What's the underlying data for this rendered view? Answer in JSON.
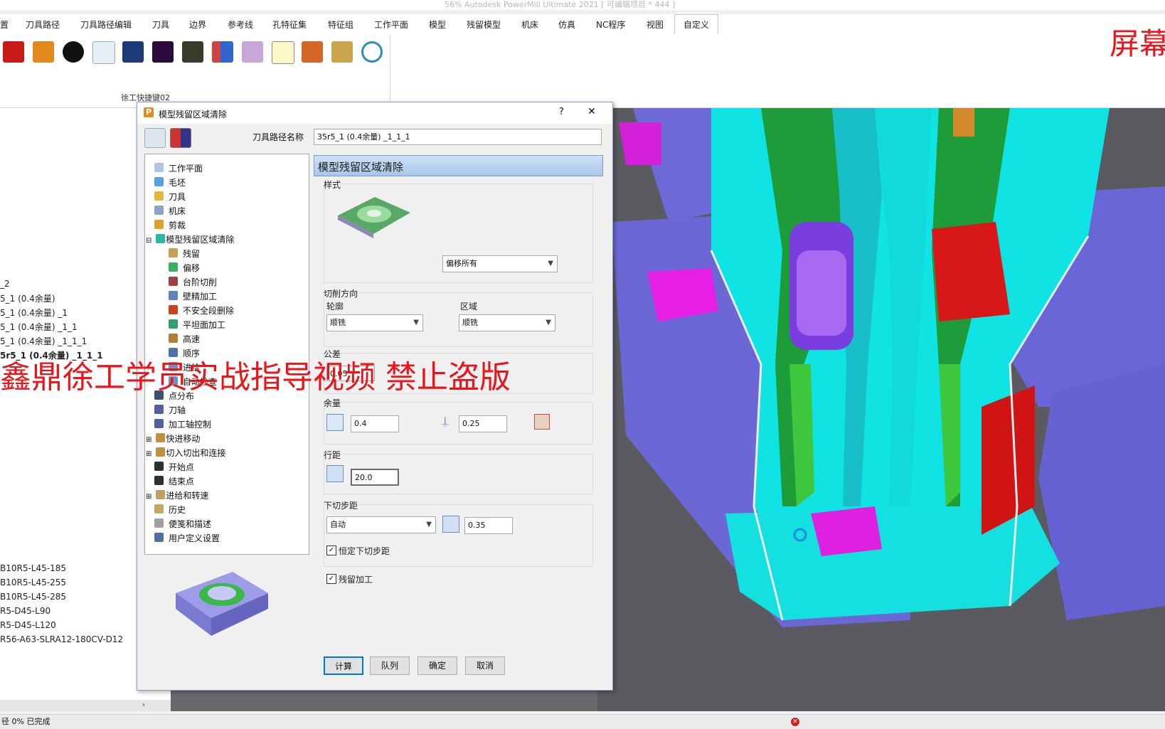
{
  "window": {
    "title": "56% Autodesk PowerMill Ultimate 2021    [ 可编辑项目 * 444 ]"
  },
  "ribbon": {
    "tabs": [
      "置",
      "刀具路径",
      "刀具路径编辑",
      "刀具",
      "边界",
      "参考线",
      "孔特征集",
      "特征组",
      "工作平面",
      "模型",
      "残留模型",
      "机床",
      "仿真",
      "NC程序",
      "视图",
      "自定义"
    ],
    "group_label": "徐工快捷键02"
  },
  "left_panel": {
    "items": [
      "_2",
      "5_1 (0.4余量)",
      "5_1 (0.4余量) _1",
      "5_1 (0.4余量) _1_1",
      "5_1 (0.4余量) _1_1_1",
      "5r5_1 (0.4余量) _1_1_1",
      "",
      "",
      "B10R5-L45-185",
      "B10R5-L45-255",
      "B10R5-L45-285",
      "R5-D45-L90",
      "R5-D45-L120",
      "R56-A63-SLRA12-180CV-D12"
    ]
  },
  "status": {
    "text": "径  0% 已完成"
  },
  "dialog": {
    "title": "模型残留区域清除",
    "help": "?",
    "close": "✕",
    "toolpath_name_label": "刀具路径名称",
    "toolpath_name": "35r5_1 (0.4余量) _1_1_1",
    "section_title": "模型残留区域清除",
    "tree": [
      "工作平面",
      "毛坯",
      "刀具",
      "机床",
      "剪裁",
      "模型残留区域清除",
      "残留",
      "偏移",
      "台阶切削",
      "壁精加工",
      "不安全段删除",
      "平坦面加工",
      "高速",
      "顺序",
      "进给",
      "自动检查",
      "点分布",
      "刀轴",
      "加工轴控制",
      "快进移动",
      "切入切出和连接",
      "开始点",
      "结束点",
      "进给和转速",
      "历史",
      "便笺和描述",
      "用户定义设置"
    ],
    "style_label": "样式",
    "style_value": "偏移所有",
    "cut_direction_label": "切削方向",
    "profile_label": "轮廓",
    "profile_value": "顺铣",
    "area_label": "区域",
    "area_value": "顺铣",
    "tolerance_label": "公差",
    "tolerance_value": "0.05",
    "allowance_label": "余量",
    "radial_allowance": "0.4",
    "axial_allowance": "0.25",
    "stepover_label": "行距",
    "stepover_value": "20.0",
    "stepdown_label": "下切步距",
    "stepdown_mode": "自动",
    "stepdown_value": "0.35",
    "const_stepdown_label": "恒定下切步距",
    "rest_machining_label": "残留加工",
    "buttons": {
      "calculate": "计算",
      "queue": "队列",
      "ok": "确定",
      "cancel": "取消"
    }
  },
  "overlay": {
    "watermark_main": "鑫鼎徐工学员实战指导视频  禁止盗版",
    "watermark_corner": "屏幕"
  }
}
